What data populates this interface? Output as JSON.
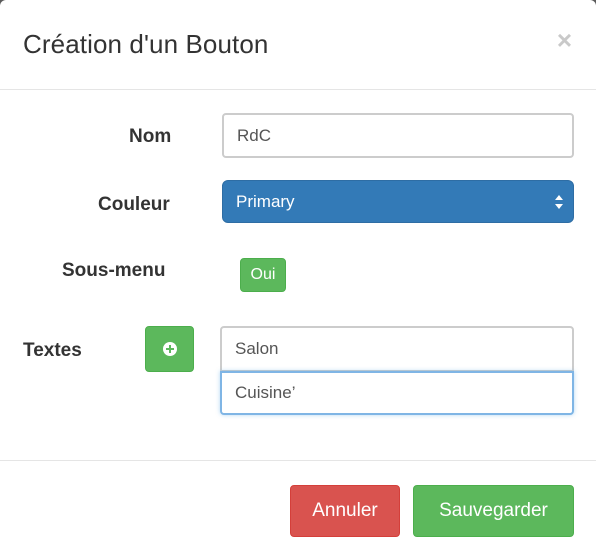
{
  "modal": {
    "title": "Création d'un Bouton",
    "close_symbol": "×"
  },
  "form": {
    "name_label": "Nom",
    "name_value": "RdC",
    "color_label": "Couleur",
    "color_selected": "Primary",
    "submenu_label": "Sous-menu",
    "submenu_toggle": "Oui",
    "texts_label": "Textes",
    "add_text_icon": "plus-circle-icon",
    "texts": [
      "Salon",
      "Cuisine’"
    ]
  },
  "footer": {
    "cancel_label": "Annuler",
    "save_label": "Sauvegarder"
  },
  "colors": {
    "primary": "#337ab7",
    "success": "#5cb85c",
    "danger": "#d9534f"
  }
}
